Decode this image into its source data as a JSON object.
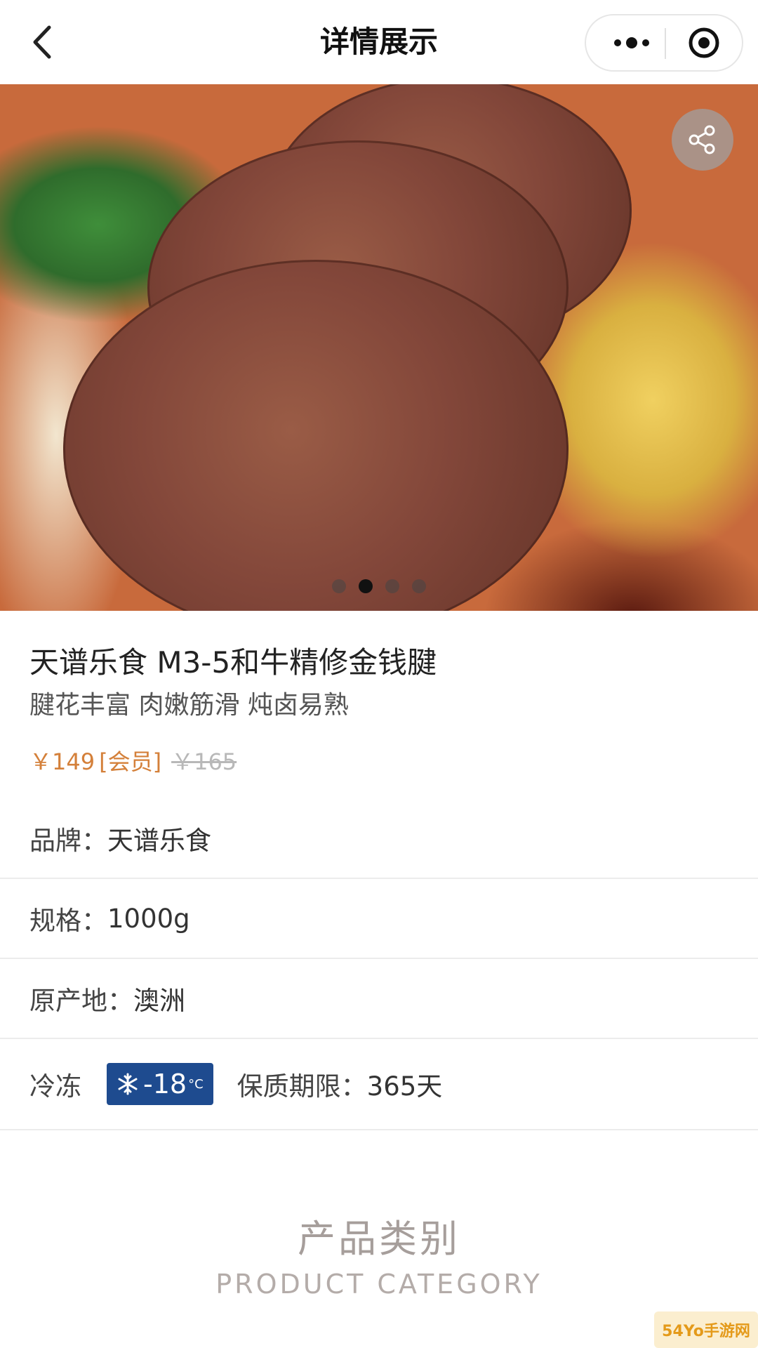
{
  "navbar": {
    "title": "详情展示",
    "back_icon": "chevron-left-icon",
    "more_icon": "more-dots-icon",
    "close_icon": "target-icon"
  },
  "hero": {
    "share_icon": "share-icon",
    "carousel": {
      "count": 4,
      "active_index": 1
    }
  },
  "product": {
    "title": "天谱乐食 M3-5和牛精修金钱腱",
    "subtitle": "腱花丰富 肉嫩筋滑 炖卤易熟",
    "price": "￥149",
    "member_tag": "[会员]",
    "original_price": "￥165",
    "price_color": "#d4803a"
  },
  "details": {
    "brand_label": "品牌：",
    "brand_value": "天谱乐食",
    "spec_label": "规格：",
    "spec_value": "1000g",
    "origin_label": "原产地：",
    "origin_value": "澳洲",
    "storage_label": "冷冻",
    "frozen_temp": "-18",
    "frozen_unit": "°C",
    "frozen_badge_color": "#1e4b8f",
    "shelf_life_label": "保质期限：",
    "shelf_life_value": "365天"
  },
  "category": {
    "title_cn": "产品类别",
    "title_en": "PRODUCT CATEGORY"
  },
  "watermark": {
    "text": "54Yo手游网"
  }
}
